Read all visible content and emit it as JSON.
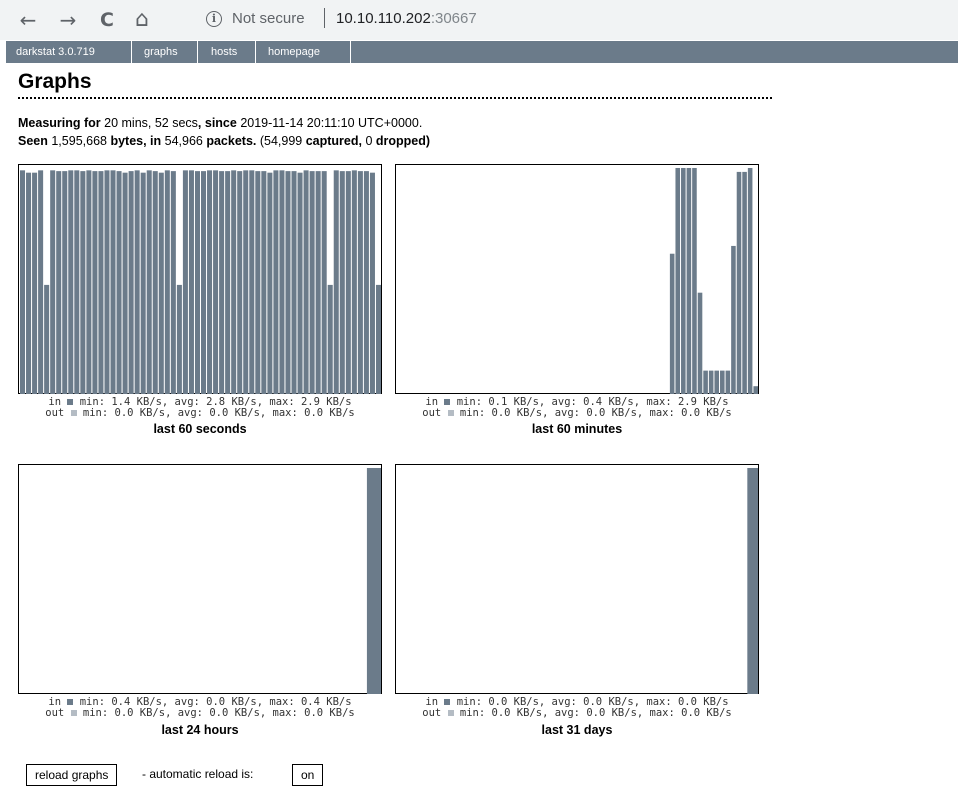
{
  "browser": {
    "back": "←",
    "forward": "→",
    "reload": "C",
    "home": "⌂",
    "info": "i",
    "security": "Not secure",
    "url_host": "10.10.110.202",
    "url_port": ":30667"
  },
  "menu": {
    "items": [
      "darkstat 3.0.719",
      "graphs",
      "hosts",
      "homepage"
    ]
  },
  "page": {
    "title": "Graphs",
    "measuring": {
      "label1": "Measuring for ",
      "duration": "20 mins, 52 secs",
      "label2": ", since ",
      "since": "2019-11-14 20:11:10 UTC+0000",
      "end": "."
    },
    "seen": {
      "label1": "Seen ",
      "bytes": "1,595,668",
      "label2": " bytes, in ",
      "packets": "54,966",
      "label3": " packets.",
      "paren_open": " (",
      "captured": "54,999",
      "label4": " captured, ",
      "dropped": "0",
      "label5": " dropped)"
    }
  },
  "colors": {
    "in_bar": "#6b7b8a",
    "out_bar": "#b4bcc4"
  },
  "graphs": [
    {
      "title": "last 60 seconds",
      "in_legend": "in",
      "in_stats": "min: 1.4 KB/s, avg: 2.8 KB/s, max: 2.9 KB/s",
      "out_legend": "out",
      "out_stats": "min: 0.0 KB/s, avg: 0.0 KB/s, max: 0.0 KB/s",
      "max": 2.9,
      "in_values": [
        2.87,
        2.84,
        2.84,
        2.87,
        1.4,
        2.87,
        2.86,
        2.86,
        2.87,
        2.87,
        2.86,
        2.87,
        2.86,
        2.86,
        2.87,
        2.87,
        2.86,
        2.84,
        2.86,
        2.87,
        2.84,
        2.87,
        2.86,
        2.84,
        2.87,
        2.86,
        1.4,
        2.87,
        2.87,
        2.86,
        2.86,
        2.87,
        2.87,
        2.86,
        2.86,
        2.87,
        2.86,
        2.87,
        2.87,
        2.86,
        2.86,
        2.84,
        2.87,
        2.87,
        2.86,
        2.86,
        2.84,
        2.87,
        2.86,
        2.86,
        2.86,
        1.4,
        2.87,
        2.86,
        2.86,
        2.87,
        2.86,
        2.86,
        2.84,
        1.4
      ]
    },
    {
      "title": "last 60 minutes",
      "in_legend": "in",
      "in_stats": "min: 0.1 KB/s, avg: 0.4 KB/s, max: 2.9 KB/s",
      "out_legend": "out",
      "out_stats": "min: 0.0 KB/s, avg: 0.0 KB/s, max: 0.0 KB/s",
      "max": 2.9,
      "in_values": [
        0,
        0,
        0,
        0,
        0,
        0,
        0,
        0,
        0,
        0,
        0,
        0,
        0,
        0,
        0,
        0,
        0,
        0,
        0,
        0,
        0,
        0,
        0,
        0,
        0,
        0,
        0,
        0,
        0,
        0,
        0,
        0,
        0,
        0,
        0,
        0,
        0,
        0,
        0,
        0,
        0,
        0,
        0,
        0,
        0,
        0,
        0,
        0,
        0,
        1.8,
        2.9,
        2.9,
        2.9,
        2.9,
        1.3,
        0.3,
        0.3,
        0.3,
        0.3,
        0.3,
        1.9,
        2.85,
        2.85,
        2.9,
        0.1
      ]
    },
    {
      "title": "last 24 hours",
      "in_legend": "in",
      "in_stats": "min: 0.4 KB/s, avg: 0.0 KB/s, max: 0.4 KB/s",
      "out_legend": "out",
      "out_stats": "min: 0.0 KB/s, avg: 0.0 KB/s, max: 0.0 KB/s",
      "max": 0.4,
      "in_values": [
        0,
        0,
        0,
        0,
        0,
        0,
        0,
        0,
        0,
        0,
        0,
        0,
        0,
        0,
        0,
        0,
        0,
        0,
        0,
        0,
        0,
        0,
        0,
        0.4
      ]
    },
    {
      "title": "last 31 days",
      "in_legend": "in",
      "in_stats": "min: 0.0 KB/s, avg: 0.0 KB/s, max: 0.0 KB/s",
      "out_legend": "out",
      "out_stats": "min: 0.0 KB/s, avg: 0.0 KB/s, max: 0.0 KB/s",
      "max": 1,
      "in_values": [
        0,
        0,
        0,
        0,
        0,
        0,
        0,
        0,
        0,
        0,
        0,
        0,
        0,
        0,
        0,
        0,
        0,
        0,
        0,
        0,
        0,
        0,
        0,
        0,
        0,
        0,
        0,
        0,
        0,
        0,
        1
      ]
    }
  ],
  "footer": {
    "reload_button": "reload graphs",
    "auto_text": "- automatic reload is:",
    "auto_button": "on"
  }
}
